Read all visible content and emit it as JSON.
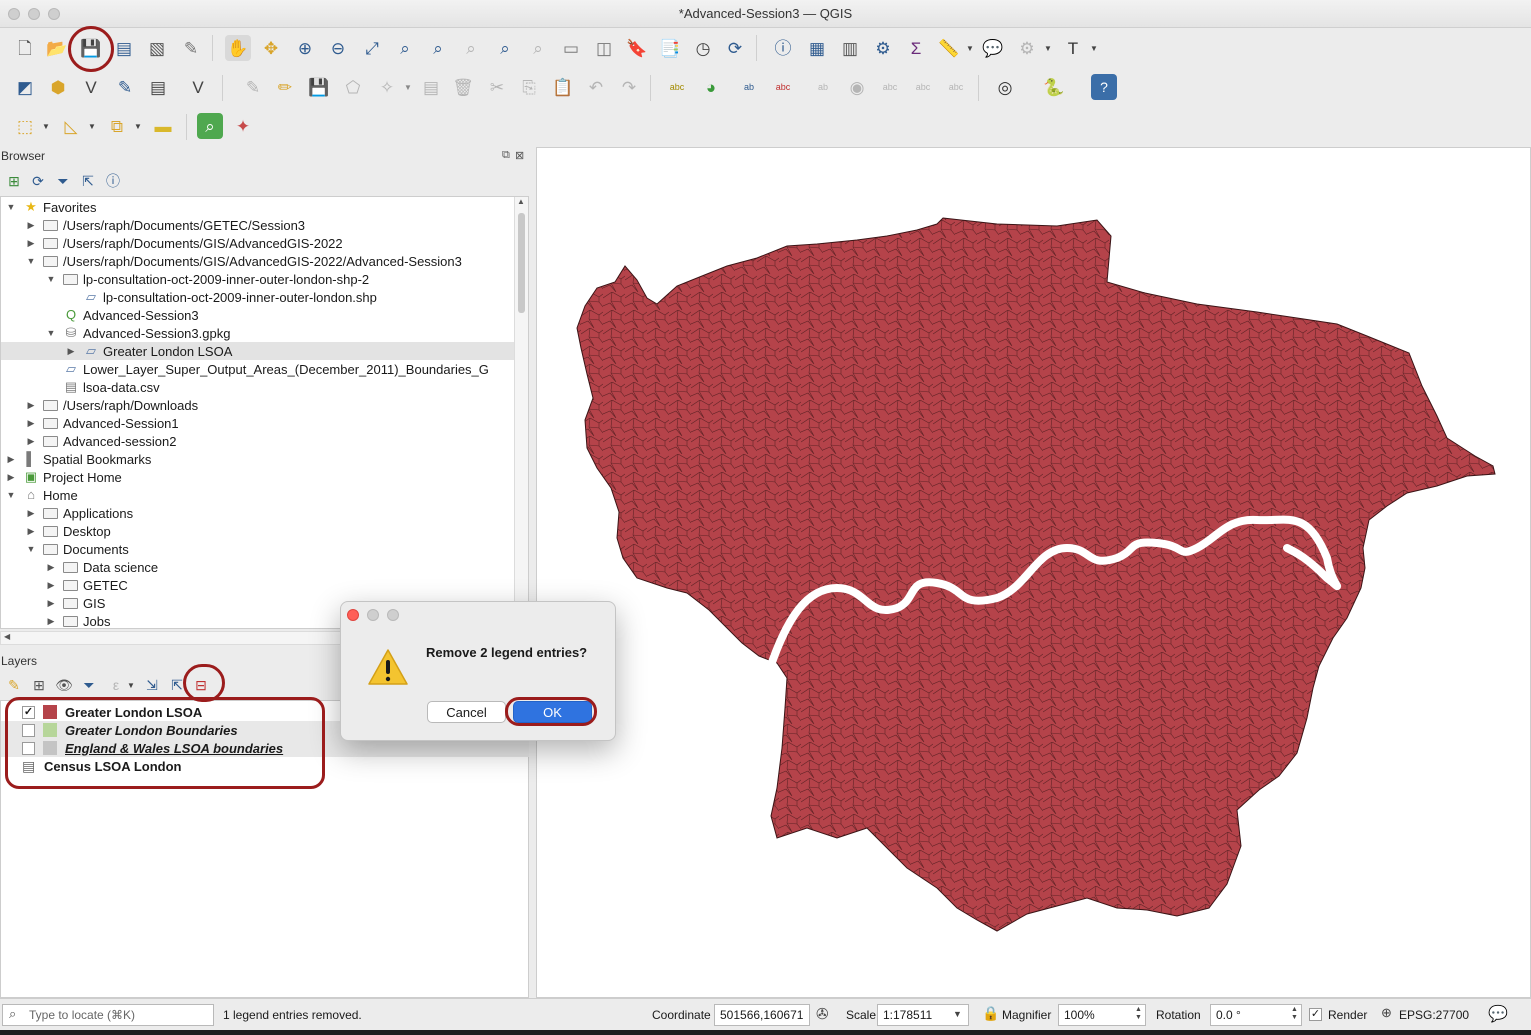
{
  "window": {
    "title": "*Advanced-Session3 — QGIS"
  },
  "browser": {
    "panel_title": "Browser",
    "items": [
      {
        "label": "Favorites",
        "indent": 0,
        "arrow": "open",
        "icon": "star-icon"
      },
      {
        "label": "/Users/raph/Documents/GETEC/Session3",
        "indent": 1,
        "arrow": "closed",
        "icon": "folder-icon"
      },
      {
        "label": "/Users/raph/Documents/GIS/AdvancedGIS-2022",
        "indent": 1,
        "arrow": "closed",
        "icon": "folder-icon"
      },
      {
        "label": "/Users/raph/Documents/GIS/AdvancedGIS-2022/Advanced-Session3",
        "indent": 1,
        "arrow": "open",
        "icon": "folder-icon"
      },
      {
        "label": "lp-consultation-oct-2009-inner-outer-london-shp-2",
        "indent": 2,
        "arrow": "open",
        "icon": "folder-icon"
      },
      {
        "label": "lp-consultation-oct-2009-inner-outer-london.shp",
        "indent": 3,
        "arrow": "none",
        "icon": "polygon-layer-icon"
      },
      {
        "label": "Advanced-Session3",
        "indent": 2,
        "arrow": "none",
        "icon": "qgis-project-icon"
      },
      {
        "label": "Advanced-Session3.gpkg",
        "indent": 2,
        "arrow": "open",
        "icon": "geopackage-icon"
      },
      {
        "label": "Greater London LSOA",
        "indent": 3,
        "arrow": "closed",
        "icon": "polygon-layer-icon",
        "selected": true
      },
      {
        "label": "Lower_Layer_Super_Output_Areas_(December_2011)_Boundaries_G",
        "indent": 2,
        "arrow": "none",
        "icon": "polygon-layer-icon"
      },
      {
        "label": "lsoa-data.csv",
        "indent": 2,
        "arrow": "none",
        "icon": "table-icon"
      },
      {
        "label": "/Users/raph/Downloads",
        "indent": 1,
        "arrow": "closed",
        "icon": "folder-icon"
      },
      {
        "label": "Advanced-Session1",
        "indent": 1,
        "arrow": "closed",
        "icon": "folder-icon"
      },
      {
        "label": "Advanced-session2",
        "indent": 1,
        "arrow": "closed",
        "icon": "folder-icon"
      },
      {
        "label": "Spatial Bookmarks",
        "indent": 0,
        "arrow": "closed",
        "icon": "bookmark-icon"
      },
      {
        "label": "Project Home",
        "indent": 0,
        "arrow": "closed",
        "icon": "project-home-icon"
      },
      {
        "label": "Home",
        "indent": 0,
        "arrow": "open",
        "icon": "home-icon"
      },
      {
        "label": "Applications",
        "indent": 1,
        "arrow": "closed",
        "icon": "folder-icon"
      },
      {
        "label": "Desktop",
        "indent": 1,
        "arrow": "closed",
        "icon": "folder-icon"
      },
      {
        "label": "Documents",
        "indent": 1,
        "arrow": "open",
        "icon": "folder-icon"
      },
      {
        "label": "Data science",
        "indent": 2,
        "arrow": "closed",
        "icon": "folder-icon"
      },
      {
        "label": "GETEC",
        "indent": 2,
        "arrow": "closed",
        "icon": "folder-icon"
      },
      {
        "label": "GIS",
        "indent": 2,
        "arrow": "closed",
        "icon": "folder-icon"
      },
      {
        "label": "Jobs",
        "indent": 2,
        "arrow": "closed",
        "icon": "folder-icon"
      }
    ]
  },
  "layers": {
    "panel_title": "Layers",
    "items": [
      {
        "label": "Greater London LSOA",
        "checked": true,
        "swatch": "#b5434a",
        "style": "bold"
      },
      {
        "label": "Greater London Boundaries",
        "checked": false,
        "swatch": "#b7d69a",
        "style": "bold-italic"
      },
      {
        "label": "England & Wales LSOA boundaries",
        "checked": false,
        "swatch": "#c4c4c4",
        "style": "bold-italic-underline"
      },
      {
        "label": "Census LSOA London",
        "checked": null,
        "icon": "table-icon",
        "style": "bold"
      }
    ]
  },
  "dialog": {
    "message": "Remove 2 legend entries?",
    "cancel_label": "Cancel",
    "ok_label": "OK",
    "icon": "warning-icon"
  },
  "status": {
    "locate_placeholder": "Type to locate (⌘K)",
    "message": "1 legend entries removed.",
    "coordinate_label": "Coordinate",
    "coordinate_value": "501566,160671",
    "scale_label": "Scale",
    "scale_value": "1:178511",
    "magnifier_label": "Magnifier",
    "magnifier_value": "100%",
    "rotation_label": "Rotation",
    "rotation_value": "0.0 °",
    "render_label": "Render",
    "render_checked": true,
    "crs_label": "EPSG:27700"
  },
  "colors": {
    "map_fill": "#b5434a",
    "map_stroke": "#3b1416",
    "annotation_ring": "#9b1c1c"
  }
}
